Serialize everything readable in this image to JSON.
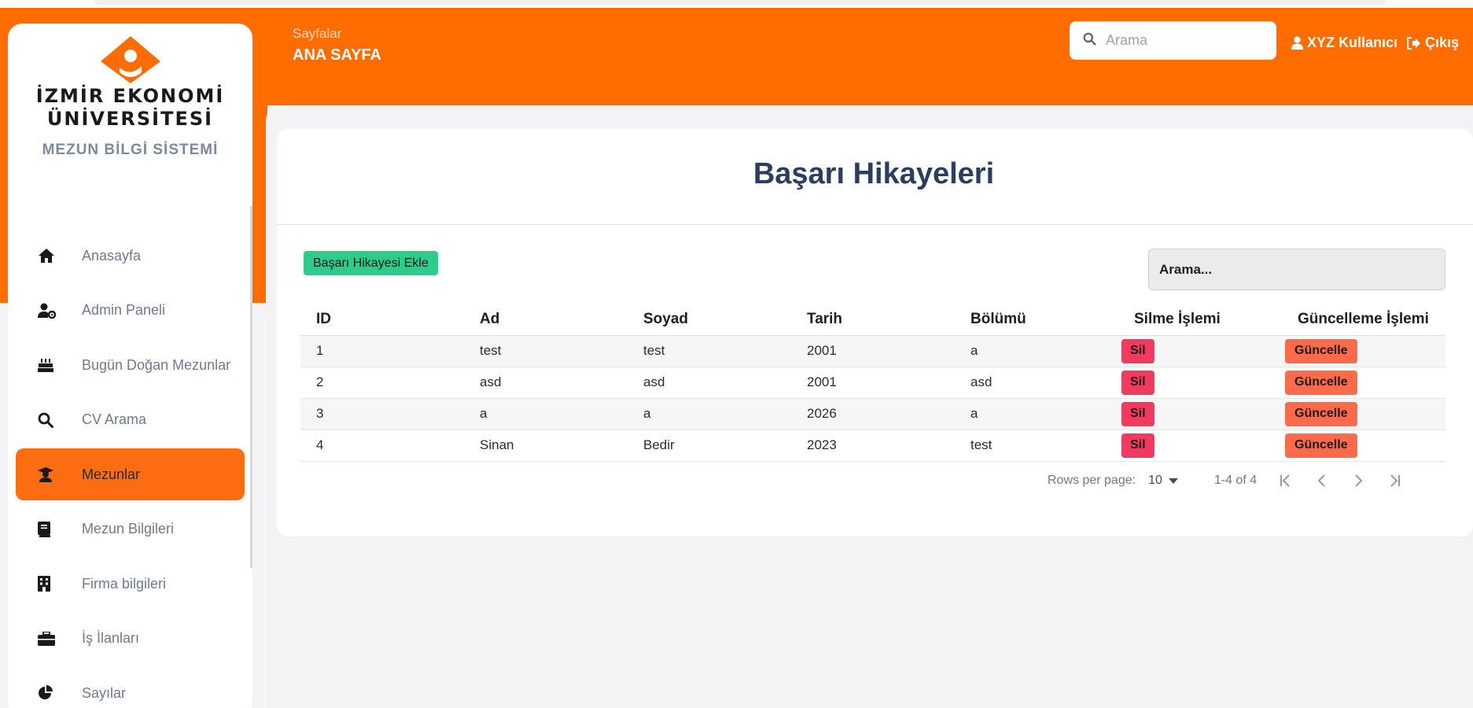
{
  "colors": {
    "brand_orange": "#ff6d00",
    "title_navy": "#2c3e60",
    "add_green": "#2ecc8a",
    "delete_red": "#f13a5f",
    "update_orange": "#ff6a4a"
  },
  "sidebar": {
    "logo": {
      "line1": "İZMİR EKONOMİ",
      "line2": "ÜNİVERSİTESİ",
      "subtitle": "MEZUN BİLGİ SİSTEMİ"
    },
    "items": [
      {
        "label": "Anasayfa",
        "icon": "home-icon"
      },
      {
        "label": "Admin Paneli",
        "icon": "user-gear-icon"
      },
      {
        "label": "Bugün Doğan Mezunlar",
        "icon": "birthday-cake-icon"
      },
      {
        "label": "CV Arama",
        "icon": "search-icon"
      },
      {
        "label": "Mezunlar",
        "icon": "graduate-icon",
        "active": true
      },
      {
        "label": "Mezun Bilgileri",
        "icon": "book-icon"
      },
      {
        "label": "Firma bilgileri",
        "icon": "building-icon"
      },
      {
        "label": "İş İlanları",
        "icon": "briefcase-icon"
      },
      {
        "label": "Sayılar",
        "icon": "pie-chart-icon"
      }
    ]
  },
  "header": {
    "breadcrumb": "Sayfalar",
    "title": "ANA SAYFA",
    "search_placeholder": "Arama",
    "user_label": "XYZ Kullanıcı",
    "logout_label": "Çıkış"
  },
  "main": {
    "title": "Başarı Hikayeleri",
    "add_button": "Başarı Hikayesi Ekle",
    "table_search_placeholder": "Arama...",
    "columns": [
      "ID",
      "Ad",
      "Soyad",
      "Tarih",
      "Bölümü",
      "Silme İşlemi",
      "Güncelleme İşlemi"
    ],
    "rows": [
      {
        "id": "1",
        "ad": "test",
        "soyad": "test",
        "tarih": "2001",
        "bolum": "a"
      },
      {
        "id": "2",
        "ad": "asd",
        "soyad": "asd",
        "tarih": "2001",
        "bolum": "asd"
      },
      {
        "id": "3",
        "ad": "a",
        "soyad": "a",
        "tarih": "2026",
        "bolum": "a"
      },
      {
        "id": "4",
        "ad": "Sinan",
        "soyad": "Bedir",
        "tarih": "2023",
        "bolum": "test"
      }
    ],
    "delete_label": "Sil",
    "update_label": "Güncelle",
    "pagination": {
      "rows_per_page_label": "Rows per page:",
      "rows_per_page_value": "10",
      "range_text": "1-4 of 4"
    }
  }
}
